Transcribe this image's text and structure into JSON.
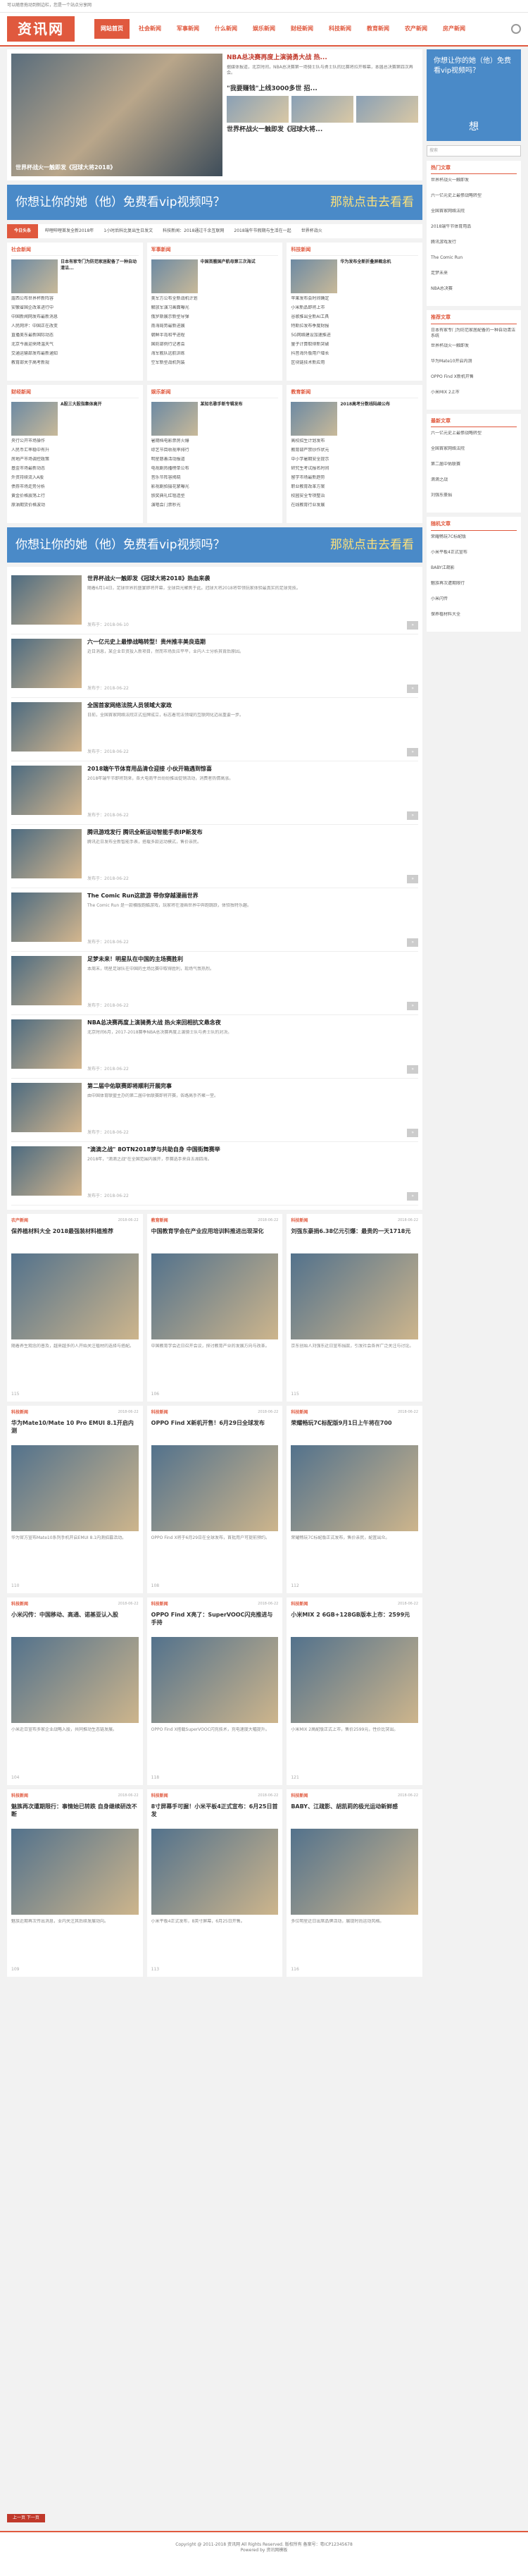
{
  "topbar": {
    "text": "可以随意拖动到侧边栏，您是一个站点分享网"
  },
  "logo": "资讯网",
  "nav": [
    "网站首页",
    "社会新闻",
    "军事新闻",
    "什么新闻",
    "娱乐新闻",
    "财经新闻",
    "科技新闻",
    "教育新闻",
    "农产新闻",
    "房产新闻"
  ],
  "hero": {
    "caption": "世界杯战火一触即发《冠球大将2018》",
    "title": "NBA总决赛再度上演骑勇大战 热...",
    "desc": "据媒体报道，北京时间，NBA总决赛第一场骑士队与勇士队的比赛将拉开帷幕，本届总决赛第四次再会。",
    "sub": "\"我要赚钱\"上线3000多世 招...",
    "sub2": "世界杯战火一触即发《冠球大将..."
  },
  "banner": {
    "text": "你想让你的她（他）免费看vip视频吗？",
    "cta": "那就点击去看看"
  },
  "ticker": {
    "label": "今日头条",
    "items": [
      "哔哩哔哩首发全新2018年",
      "1小时后科比复出生日发文",
      "科技新闻：2018通过千余互联网",
      "2018端午节假期与生活在一起",
      "世界杯战火"
    ]
  },
  "columns": [
    {
      "title": "社会新闻",
      "top": "日本有家专门为防范家居配备了一种自动清洁...",
      "items": [
        "露西公布世界杯新阵容",
        "安徽省国企改革进行中",
        "中国新闻网发布最新消息",
        "人民网评：中国正在改变",
        "直播美东最新国际动态",
        "北京今晨迎来降温天气",
        "交通运输部发布最新通知",
        "教育部关于高考新规"
      ]
    },
    {
      "title": "军事新闻",
      "top": "中国首艘国产航母第三次海试",
      "items": [
        "美军方公布全新战机计划",
        "解放军演习画面曝光",
        "俄罗斯展示新型导弹",
        "南海局势最新进展",
        "朝鲜半岛和平进程",
        "国防部例行记者会",
        "海军舰队远航训练",
        "空军新型战机列装"
      ]
    },
    {
      "title": "科技新闻",
      "top": "华为发布全新折叠屏概念机",
      "items": [
        "苹果发布会时间确定",
        "小米新品即将上市",
        "谷歌推出全新AI工具",
        "特斯拉发布季度财报",
        "5G网络建设加速推进",
        "量子计算取得新突破",
        "抖音海外版用户增长",
        "区块链技术新应用"
      ]
    }
  ],
  "columns2": [
    {
      "title": "财经新闻",
      "top": "A股三大股指集体高开",
      "items": [
        "央行公开市场操作",
        "人民币汇率稳中有升",
        "房地产市场调控政策",
        "基金市场最新动态",
        "外资持续流入A股",
        "债券市场走势分析",
        "黄金价格震荡上行",
        "原油期货价格波动"
      ]
    },
    {
      "title": "娱乐新闻",
      "top": "某知名歌手新专辑发布",
      "items": [
        "暑期档电影票房火爆",
        "综艺节目收视率排行",
        "明星慈善活动报道",
        "电视剧热播榜单公布",
        "音乐节阵容揭晓",
        "影视剧拍摄花絮曝光",
        "颁奖典礼红毯造型",
        "演唱会门票秒光"
      ]
    },
    {
      "title": "教育新闻",
      "top": "2018高考分数线陆续公布",
      "items": [
        "高校招生计划发布",
        "教育部严禁炒作状元",
        "中小学暑期安全提示",
        "研究生考试报名时间",
        "留学市场最新趋势",
        "职业教育改革方案",
        "校园安全专项整治",
        "在线教育行业发展"
      ]
    }
  ],
  "articles": [
    {
      "title": "世界杯战火一触即发《冠球大将2018》热血来袭",
      "desc": "随着6月14日，足球世界的盛宴即将开幕，全球目光聚焦于此。冠球大将2018将带领玩家体验最真实的足球竞技。",
      "meta": "发布于：2018-06-10"
    },
    {
      "title": "六一亿元史上最惨战略转型！贵州推丰美良造期",
      "desc": "近日消息，某企业巨资投入新项目，然而市场反应平平，业内人士分析其背后原因。",
      "meta": "发布于：2018-06-22"
    },
    {
      "title": "全国首家网络法院人员领域大家政",
      "desc": "日前，全国首家网络法院正式挂牌成立，标志着司法领域的互联网化迈出重要一步。",
      "meta": "发布于：2018-06-22"
    },
    {
      "title": "2018端午节体育用品清仓迎接 小伙开箱遇到惊喜",
      "desc": "2018年端午节即将到来，各大电商平台纷纷推出促销活动，消费者热情高涨。",
      "meta": "发布于：2018-06-22"
    },
    {
      "title": "腾讯游戏发行 腾讯全新运动智能手表IP新发布",
      "desc": "腾讯近日发布全新智能手表，搭载多款运动模式，售价亲民。",
      "meta": "发布于：2018-06-22"
    },
    {
      "title": "The Comic Run这款游 带你穿越漫画世界",
      "desc": "The Comic Run 是一款横版跑酷游戏，玩家将在漫画世界中奔跑跳跃，体验独特乐趣。",
      "meta": "发布于：2018-06-22"
    },
    {
      "title": "足梦未来！明星队在中国的主场赛胜利",
      "desc": "本周末，明星足球队在中国的主场比赛中取得胜利，现场气氛热烈。",
      "meta": "发布于：2018-06-22"
    },
    {
      "title": "NBA总决赛再度上演骑勇大战 热火来回相抗文悬念夜",
      "desc": "北京时间6月，2017-2018赛季NBA总决赛再度上演骑士队与勇士队的对决。",
      "meta": "发布于：2018-06-22"
    },
    {
      "title": "第二届中佑联赛即将顺利开展完事",
      "desc": "由中国体育联盟主办的第二届中佑联赛即将开赛，各路高手齐聚一堂。",
      "meta": "发布于：2018-06-22"
    },
    {
      "title": "\"滴滴之战\" 8OTN2018梦与共助自身 中国街舞赛举",
      "desc": "2018年，\"滴滴之战\"在全国范围内展开，参赛选手来自五湖四海。",
      "meta": "发布于：2018-06-22"
    }
  ],
  "grid": [
    {
      "cat": "农产新闻",
      "date": "2018-06-22",
      "title": "保养植材料大全 2018最强装材料植推荐",
      "desc": "随着养生观念的普及，越来越多的人开始关注植材的选择与搭配。",
      "views": "115"
    },
    {
      "cat": "教育新闻",
      "date": "2018-06-22",
      "title": "中国教育学会在产业应用培训料推进出现深化",
      "desc": "中国教育学会近日召开会议，探讨教育产业的发展方向与改革。",
      "views": "106"
    },
    {
      "cat": "科技新闻",
      "date": "2018-06-22",
      "title": "刘强东豪捐6.38亿元引爆：最贵的一天1718元",
      "desc": "京东创始人刘强东近日宣布捐款，引发社会各界广泛关注与讨论。",
      "views": "115"
    },
    {
      "cat": "科技新闻",
      "date": "2018-06-22",
      "title": "华为Mate10/Mate 10 Pro EMUI 8.1开启内测",
      "desc": "华为官方宣布Mate10系列手机开启EMUI 8.1内测招募活动。",
      "views": "110"
    },
    {
      "cat": "科技新闻",
      "date": "2018-06-22",
      "title": "OPPO Find X新机开售！6月29日全球发布",
      "desc": "OPPO Find X将于6月29日在全球发布，首批用户可提前预约。",
      "views": "108"
    },
    {
      "cat": "科技新闻",
      "date": "2018-06-22",
      "title": "荣耀畅玩7C标配版9月1日上午将在700",
      "desc": "荣耀畅玩7C标配版正式发布，售价亲民，配置出众。",
      "views": "112"
    },
    {
      "cat": "科技新闻",
      "date": "2018-06-22",
      "title": "小米闪传：中国移动、高通、诺基亚认入股",
      "desc": "小米近日宣布多家企业战略入股，共同推动生态链发展。",
      "views": "104"
    },
    {
      "cat": "科技新闻",
      "date": "2018-06-22",
      "title": "OPPO Find X亮了：SuperVOOC闪充推进与手持",
      "desc": "OPPO Find X搭载SuperVOOC闪充技术，充电速度大幅提升。",
      "views": "118"
    },
    {
      "cat": "科技新闻",
      "date": "2018-06-22",
      "title": "小米MIX 2 6GB+128GB版本上市：2599元",
      "desc": "小米MIX 2高配版正式上市，售价2599元，性价比突出。",
      "views": "121"
    },
    {
      "cat": "科技新闻",
      "date": "2018-06-22",
      "title": "魅族再次遭期限行：事情始已转跌 自身继续研改不断",
      "desc": "魅族近期再次传出消息，业内关注其后续发展动向。",
      "views": "109"
    },
    {
      "cat": "科技新闻",
      "date": "2018-06-22",
      "title": "8寸屏幕手可握！小米平板4正式宣布：6月25日首发",
      "desc": "小米平板4正式发布，8英寸屏幕，6月25日开售。",
      "views": "113"
    },
    {
      "cat": "科技新闻",
      "date": "2018-06-22",
      "title": "BABY、江疏影、胡凯莉的极光运动新鲜感",
      "desc": "多位明星近日出席品牌活动，展现时尚运动风格。",
      "views": "116"
    }
  ],
  "side": {
    "ad": "你想让你的她（他）免费看vip视频吗？",
    "ad_cta": "想",
    "search_placeholder": "搜索",
    "hot_title": "热门文章",
    "hot": [
      "世界杯战火一触即发",
      "六一亿元史上最惨战略转型",
      "全国首家网络法院",
      "2018端午节体育用品",
      "腾讯游戏发行",
      "The Comic Run",
      "足梦未来",
      "NBA总决赛"
    ],
    "rec_title": "推荐文章",
    "rec": [
      "日本有家专门为防范家居配备的一种自动清洁系统",
      "世界杯战火一触即发",
      "华为Mate10开启内测",
      "OPPO Find X新机开售",
      "小米MIX 2上市"
    ],
    "new_title": "最新文章",
    "new": [
      "六一亿元史上最惨战略转型",
      "全国首家网络法院",
      "第二届中佑联赛",
      "滴滴之战",
      "刘强东豪捐"
    ],
    "rand_title": "随机文章",
    "rand": [
      "荣耀畅玩7C标配版",
      "小米平板4正式宣布",
      "BABY江疏影",
      "魅族再次遭期限行",
      "小米闪传",
      "保养植材料大全"
    ]
  },
  "pager": "上一页 下一页",
  "footer": {
    "line1": "Copyright @ 2011-2018 资讯网 All Rights Reserved. 版权所有 备案号：粤ICP12345678",
    "line2": "Powered by 资讯网模板"
  }
}
